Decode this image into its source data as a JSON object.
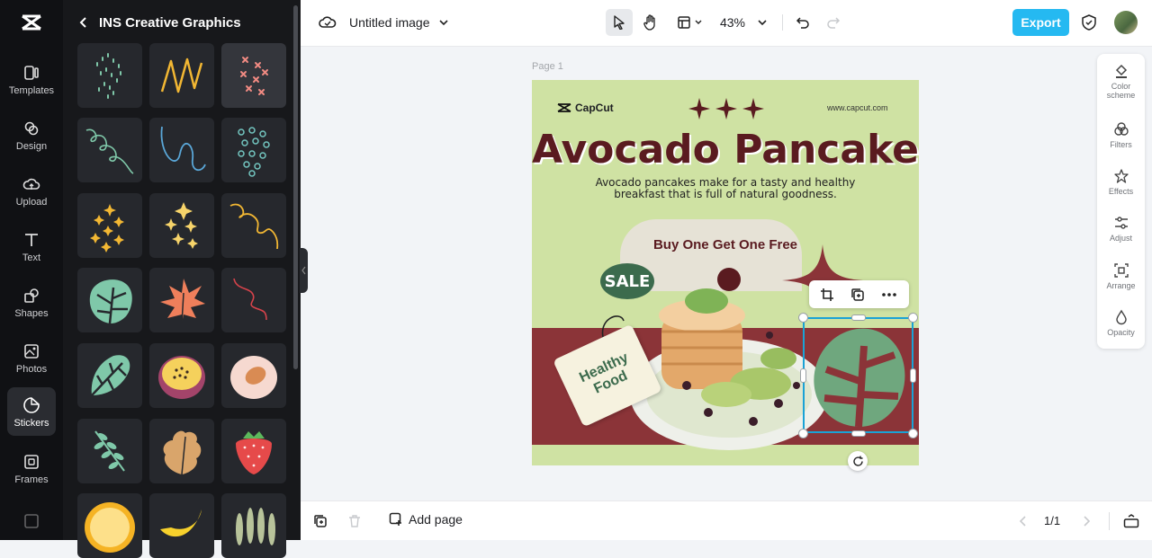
{
  "rail": {
    "items": [
      {
        "label": "Templates",
        "icon": "templates-icon"
      },
      {
        "label": "Design",
        "icon": "design-icon"
      },
      {
        "label": "Upload",
        "icon": "upload-icon"
      },
      {
        "label": "Text",
        "icon": "text-icon"
      },
      {
        "label": "Shapes",
        "icon": "shapes-icon"
      },
      {
        "label": "Photos",
        "icon": "photos-icon"
      },
      {
        "label": "Stickers",
        "icon": "stickers-icon",
        "active": true
      },
      {
        "label": "Frames",
        "icon": "frames-icon"
      }
    ]
  },
  "panel": {
    "title": "INS Creative Graphics"
  },
  "topbar": {
    "file_name": "Untitled image",
    "zoom": "43%",
    "export_label": "Export"
  },
  "right_panel": {
    "items": [
      {
        "label": "Color scheme",
        "icon": "color-scheme-icon"
      },
      {
        "label": "Filters",
        "icon": "filters-icon"
      },
      {
        "label": "Effects",
        "icon": "effects-icon"
      },
      {
        "label": "Adjust",
        "icon": "adjust-icon"
      },
      {
        "label": "Arrange",
        "icon": "arrange-icon"
      },
      {
        "label": "Opacity",
        "icon": "opacity-icon"
      }
    ]
  },
  "canvas": {
    "page_label": "Page 1",
    "brand": "CapCut",
    "url": "www.capcut.com",
    "title": "Avocado Pancake",
    "subtitle_line1": "Avocado pancakes make for a tasty and healthy",
    "subtitle_line2": "breakfast that is full of natural goodness.",
    "offer": "Buy One Get One Free",
    "sale": "SALE",
    "tag_line1": "Healthy",
    "tag_line2": "Food"
  },
  "bottombar": {
    "add_page": "Add page",
    "page_count": "1/1"
  },
  "colors": {
    "accent": "#25b9f1",
    "brand_maroon": "#5a1b20",
    "canvas_bg": "#cfe2a3",
    "selection": "#1aa2d6"
  }
}
